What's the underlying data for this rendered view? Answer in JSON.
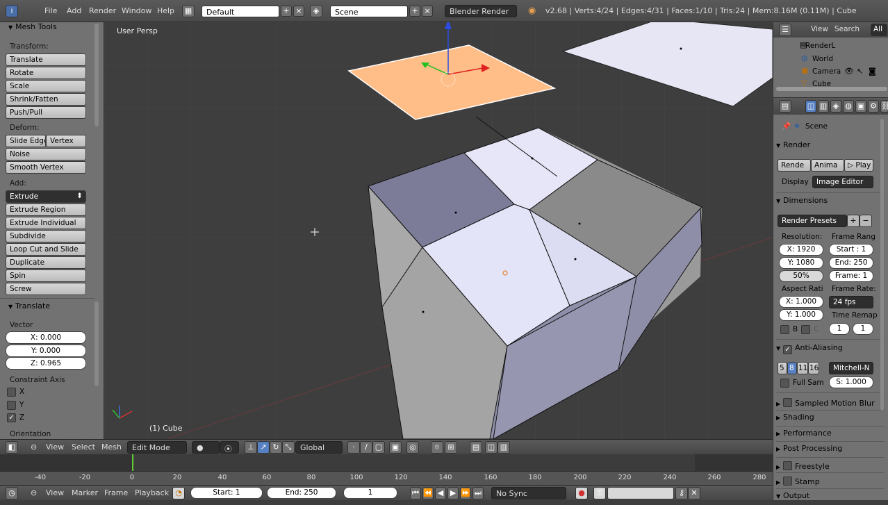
{
  "topbar": {
    "menus": [
      "File",
      "Add",
      "Render",
      "Window",
      "Help"
    ],
    "layout": "Default",
    "scene": "Scene",
    "engine": "Blender Render",
    "stats": "v2.68 | Verts:4/24 | Edges:4/31 | Faces:1/10 | Tris:24 | Mem:8.16M (0.11M) | Cube"
  },
  "toolshelf": {
    "title": "Mesh Tools",
    "transform_label": "Transform:",
    "transform_buttons": [
      "Translate",
      "Rotate",
      "Scale",
      "Shrink/Fatten",
      "Push/Pull"
    ],
    "deform_label": "Deform:",
    "slide_edge": "Slide Edge",
    "vertex": "Vertex",
    "noise": "Noise",
    "smooth_vertex": "Smooth Vertex",
    "add_label": "Add:",
    "extrude": "Extrude",
    "add_buttons": [
      "Extrude Region",
      "Extrude Individual",
      "Subdivide",
      "Loop Cut and Slide",
      "Duplicate",
      "Spin",
      "Screw"
    ],
    "operator_title": "Translate",
    "vector_label": "Vector",
    "vector": [
      "X: 0.000",
      "Y: 0.000",
      "Z: 0.965"
    ],
    "constraint_label": "Constraint Axis",
    "constraints": [
      {
        "label": "X",
        "checked": false
      },
      {
        "label": "Y",
        "checked": false
      },
      {
        "label": "Z",
        "checked": true
      }
    ],
    "orientation_label": "Orientation"
  },
  "viewport": {
    "view_label": "User Persp",
    "object_label": "(1) Cube"
  },
  "vp_header": {
    "view": "View",
    "select": "Select",
    "mesh": "Mesh",
    "mode": "Edit Mode",
    "orientation": "Global"
  },
  "timeline": {
    "ticks": [
      "-40",
      "-20",
      "0",
      "20",
      "40",
      "60",
      "80",
      "100",
      "120",
      "140",
      "160",
      "180",
      "200",
      "220",
      "240",
      "260",
      "280"
    ],
    "current_frame_marker": 0,
    "view": "View",
    "marker": "Marker",
    "frame": "Frame",
    "playback": "Playback",
    "start": "Start: 1",
    "end": "End: 250",
    "current": "1",
    "sync": "No Sync"
  },
  "outliner": {
    "view": "View",
    "search": "Search",
    "all": "All",
    "items": [
      "RenderL",
      "World",
      "Camera",
      "Cube"
    ]
  },
  "properties": {
    "scene": "Scene",
    "render_section": "Render",
    "render_btn": "Rende",
    "anim_btn": "Anima",
    "play_btn": "Play",
    "display_label": "Display",
    "display_value": "Image Editor",
    "dimensions_section": "Dimensions",
    "presets": "Render Presets",
    "resolution_label": "Resolution:",
    "res_x": "X: 1920",
    "res_y": "Y: 1080",
    "res_pct": "50%",
    "frame_range_label": "Frame Rang",
    "start": "Start : 1",
    "end": "End: 250",
    "frame": "Frame: 1",
    "aspect_label": "Aspect Rati",
    "asp_x": "X: 1.000",
    "asp_y": "Y: 1.000",
    "frame_rate_label": "Frame Rate:",
    "fps": "24 fps",
    "time_remap_label": "Time Remap",
    "b": "B",
    "c": "C",
    "remap_old": "1",
    "remap_new": "1",
    "aa_section": "Anti-Aliasing",
    "aa_samples": [
      "5",
      "8",
      "11",
      "16"
    ],
    "aa_filter": "Mitchell-N",
    "full_sample": "Full Sam",
    "size": "S: 1.000",
    "collapsed_sections": [
      "Sampled Motion Blur",
      "Shading",
      "Performance",
      "Post Processing",
      "Freestyle",
      "Stamp",
      "Output"
    ]
  }
}
